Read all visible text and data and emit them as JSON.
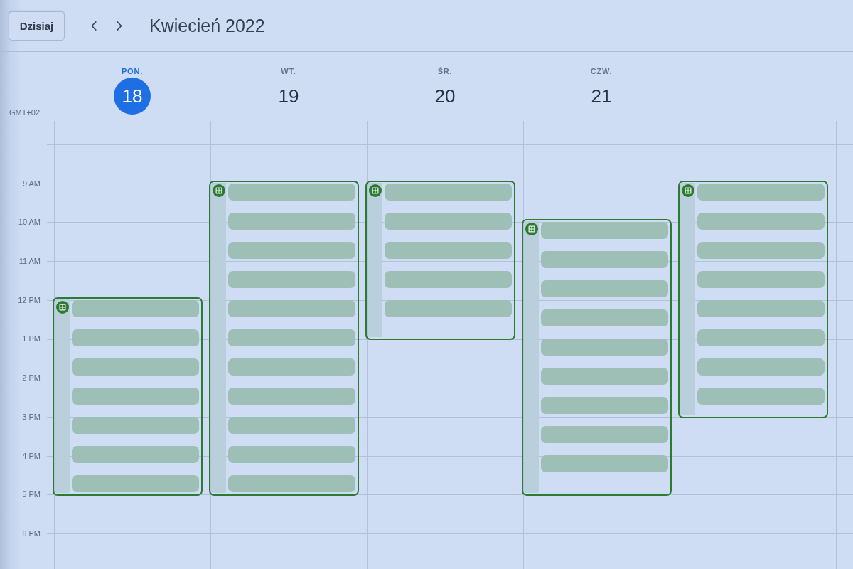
{
  "toolbar": {
    "today_button": "Dzisiaj",
    "month_title": "Kwiecień 2022"
  },
  "timezone": "GMT+02",
  "day_headers": [
    {
      "weekday": "PON.",
      "date": "18",
      "selected": true
    },
    {
      "weekday": "WT.",
      "date": "19",
      "selected": false
    },
    {
      "weekday": "ŚR.",
      "date": "20",
      "selected": false
    },
    {
      "weekday": "CZW.",
      "date": "21",
      "selected": false
    }
  ],
  "hours": [
    "9 AM",
    "10 AM",
    "11 AM",
    "12 PM",
    "1 PM",
    "2 PM",
    "3 PM",
    "4 PM",
    "5 PM",
    "6 PM"
  ],
  "day_columns": [
    {
      "events": [
        {
          "rows": [
            {
              "kind": "redacted"
            },
            {
              "kind": "redacted"
            },
            {
              "kind": "redacted"
            },
            {
              "kind": "redacted"
            },
            {
              "kind": "redacted"
            },
            {
              "kind": "redacted"
            },
            {
              "kind": "redacted"
            }
          ]
        }
      ]
    },
    {
      "events": [
        {
          "rows": [
            {
              "kind": "redacted"
            },
            {
              "kind": "redacted"
            },
            {
              "kind": "redacted"
            },
            {
              "kind": "redacted"
            },
            {
              "kind": "redacted"
            },
            {
              "kind": "redacted"
            },
            {
              "kind": "redacted"
            },
            {
              "kind": "redacted"
            },
            {
              "kind": "redacted"
            },
            {
              "kind": "redacted"
            },
            {
              "kind": "redacted"
            }
          ]
        }
      ]
    },
    {
      "events": [
        {
          "rows": [
            {
              "kind": "redacted"
            },
            {
              "kind": "redacted"
            },
            {
              "kind": "redacted"
            },
            {
              "kind": "redacted"
            },
            {
              "kind": "redacted"
            }
          ]
        }
      ]
    },
    {
      "events": [
        {
          "rows": [
            {
              "kind": "redacted"
            },
            {
              "kind": "redacted"
            },
            {
              "kind": "redacted"
            },
            {
              "kind": "redacted"
            },
            {
              "kind": "redacted"
            },
            {
              "kind": "redacted"
            },
            {
              "kind": "redacted"
            },
            {
              "kind": "redacted"
            },
            {
              "kind": "redacted"
            }
          ]
        }
      ]
    },
    {
      "events": [
        {
          "rows": [
            {
              "kind": "redacted"
            },
            {
              "kind": "redacted"
            },
            {
              "kind": "redacted"
            },
            {
              "kind": "redacted"
            },
            {
              "kind": "redacted"
            },
            {
              "kind": "redacted"
            },
            {
              "kind": "redacted"
            },
            {
              "kind": "redacted"
            }
          ]
        }
      ]
    }
  ]
}
